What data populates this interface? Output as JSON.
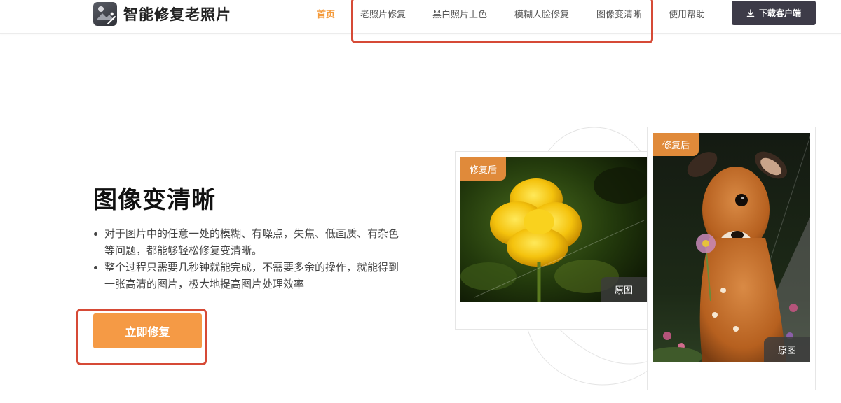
{
  "brand": {
    "name": "智能修复老照片"
  },
  "nav": {
    "items": [
      {
        "label": "首页",
        "active": true
      },
      {
        "label": "老照片修复"
      },
      {
        "label": "黑白照片上色"
      },
      {
        "label": "模糊人脸修复"
      },
      {
        "label": "图像变清晰"
      },
      {
        "label": "使用帮助"
      }
    ],
    "download_label": "下载客户端"
  },
  "hero": {
    "title": "图像变清晰",
    "bullets": [
      "对于图片中的任意一处的模糊、有噪点，失焦、低画质、有杂色等问题，都能够轻松修复变清晰。",
      "整个过程只需要几秒钟就能完成，不需要多余的操作，就能得到一张高清的图片，极大地提高图片处理效率"
    ],
    "cta_label": "立即修复"
  },
  "cards": {
    "flower": {
      "after_label": "修复后",
      "original_label": "原图"
    },
    "deer": {
      "after_label": "修复后",
      "original_label": "原图"
    }
  },
  "colors": {
    "accent": "#f49b3c",
    "cta": "#f59a45",
    "download_bg": "#3d3b48",
    "annotation": "#d64a36"
  }
}
